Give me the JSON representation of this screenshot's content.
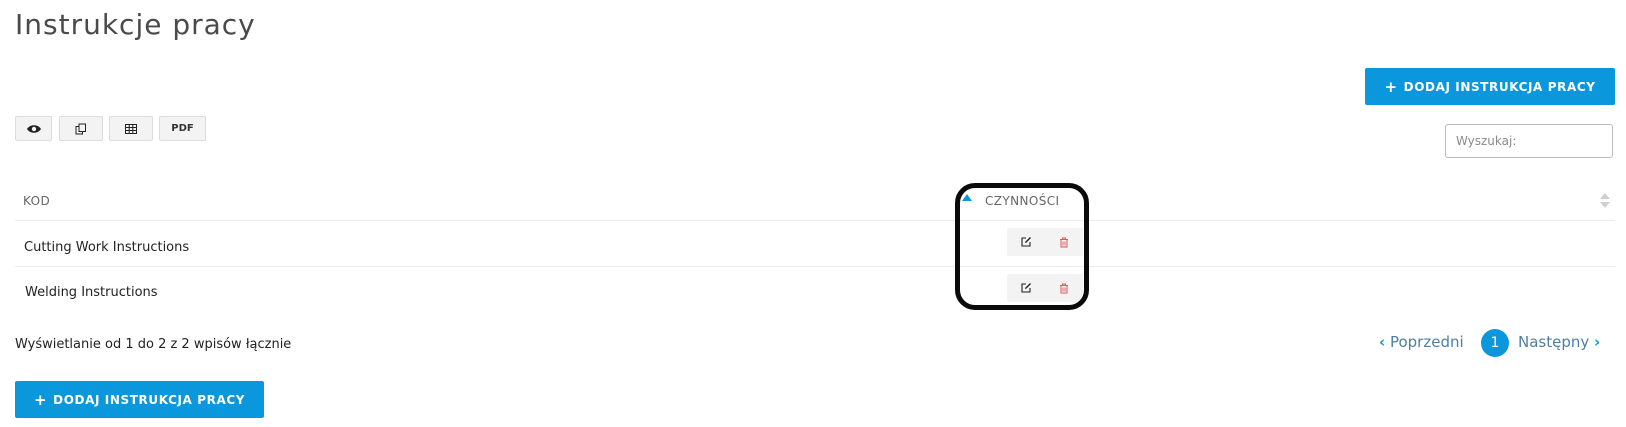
{
  "page": {
    "title": "Instrukcje pracy"
  },
  "toolbar": {
    "add_label": "DODAJ INSTRUKCJA PRACY",
    "pdf_label": "PDF"
  },
  "search": {
    "placeholder": "Wyszukaj:"
  },
  "table": {
    "columns": [
      "KOD",
      "CZYNNOŚCI"
    ],
    "rows": [
      {
        "kod": "Cutting Work Instructions"
      },
      {
        "kod": "Welding Instructions"
      }
    ]
  },
  "footer": {
    "info": "Wyświetlanie od 1 do 2 z 2 wpisów łącznie",
    "prev_label": "Poprzedni",
    "next_label": "Następny",
    "current_page": "1"
  },
  "icons": {
    "view": "eye-icon",
    "copy": "copy-icon",
    "csv": "table-icon",
    "edit": "edit-icon",
    "delete": "trash-icon"
  },
  "colors": {
    "primary": "#0b97dc",
    "delete": "#e05555",
    "highlight": "#0a0a0a"
  }
}
